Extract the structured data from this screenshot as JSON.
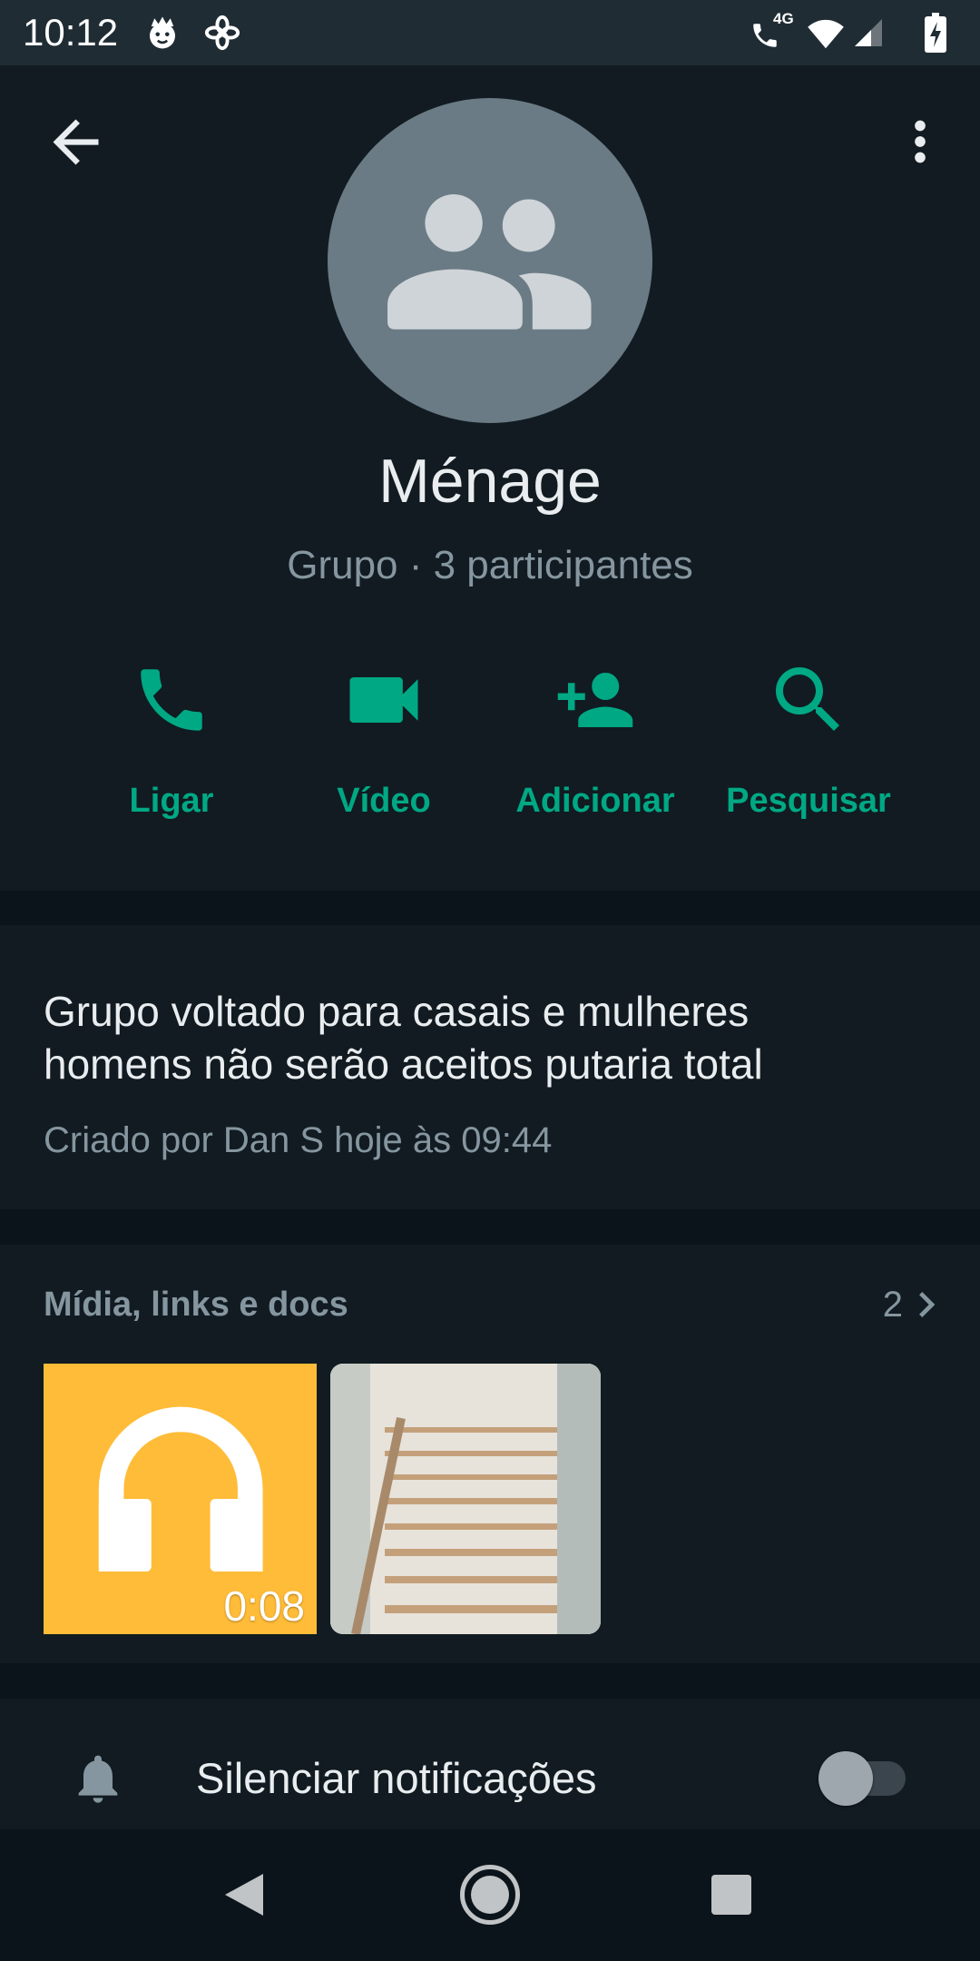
{
  "status_bar": {
    "time": "10:12",
    "network": "4G",
    "notification_icons": [
      "app-notification-icon",
      "pinwheel-icon"
    ],
    "status_icons": [
      "volte-call-icon",
      "wifi-icon",
      "signal-icon",
      "battery-charging-icon"
    ]
  },
  "toolbar": {
    "back_icon": "arrow-back-icon",
    "menu_icon": "more-vert-icon"
  },
  "group": {
    "avatar_icon": "group-icon",
    "name": "Ménage",
    "subtitle": "Grupo · 3 participantes"
  },
  "actions": [
    {
      "label": "Ligar",
      "icon": "phone-icon"
    },
    {
      "label": "Vídeo",
      "icon": "video-icon"
    },
    {
      "label": "Adicionar",
      "icon": "add-person-icon"
    },
    {
      "label": "Pesquisar",
      "icon": "search-icon"
    }
  ],
  "description": {
    "lines": [
      "Grupo voltado para casais e mulheres",
      "homens não serão aceitos putaria total"
    ],
    "created": "Criado por Dan S hoje às 09:44"
  },
  "media": {
    "title": "Mídia, links e docs",
    "count": "2",
    "chevron_icon": "chevron-right-icon",
    "items": [
      {
        "icon": "headphones-icon",
        "duration": "0:08",
        "background": "#ffbc38"
      },
      {
        "background": "#e7e3db"
      }
    ]
  },
  "notifications": {
    "label": "Silenciar notificações",
    "icon": "bell-icon",
    "muted": false
  },
  "nav_bar": {
    "icons": [
      "nav-back-icon",
      "nav-home-icon",
      "nav-recents-icon"
    ]
  },
  "colors": {
    "background": "#111b21",
    "status_bar": "#1f2c34",
    "divider": "#0b141a",
    "accent": "#00a884",
    "primary_text": "#e9edef",
    "secondary_text": "#8696a0",
    "avatar": "#6a7b85"
  }
}
